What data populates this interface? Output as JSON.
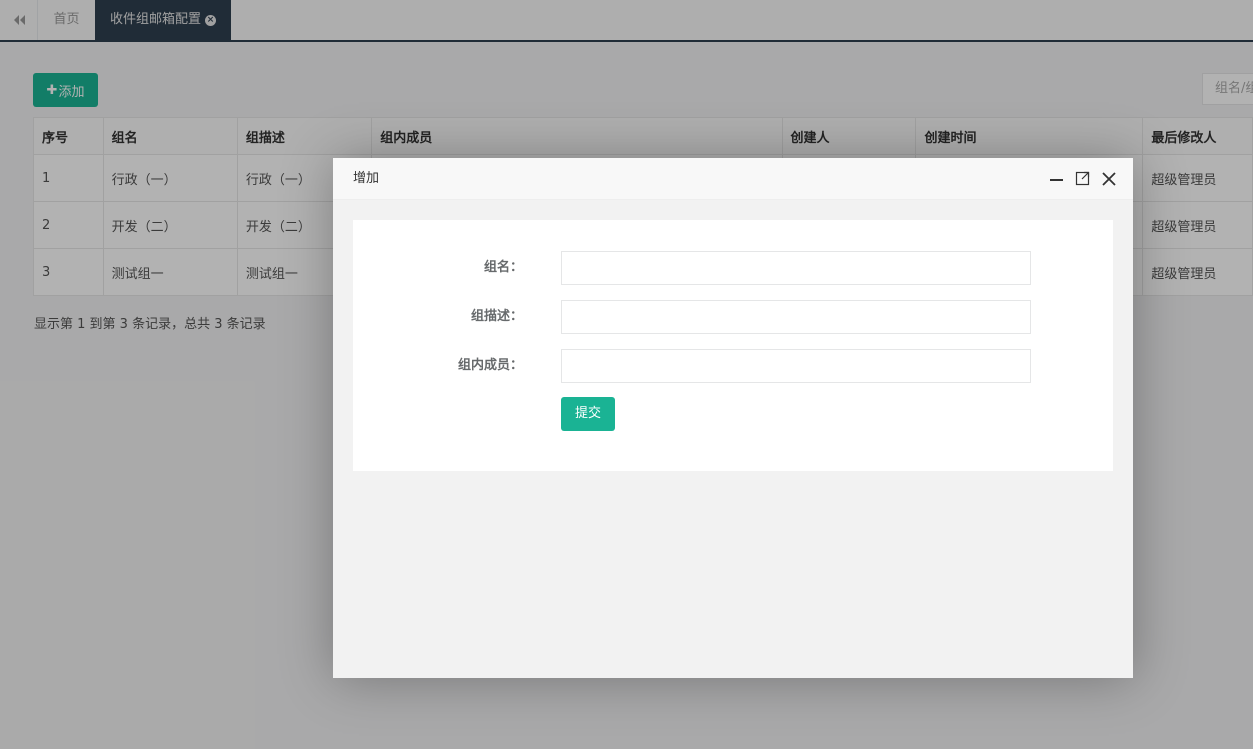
{
  "tabs": {
    "home_label": "首页",
    "active_label": "收件组邮箱配置"
  },
  "toolbar": {
    "add_label": "添加",
    "search_placeholder": "组名/组"
  },
  "table": {
    "headers": [
      "序号",
      "组名",
      "组描述",
      "组内成员",
      "创建人",
      "创建时间",
      "最后修改人"
    ],
    "rows": [
      [
        "1",
        "行政（一）",
        "行政（一）",
        "",
        "",
        "",
        "超级管理员"
      ],
      [
        "2",
        "开发（二）",
        "开发（二）",
        "",
        "",
        "",
        "超级管理员"
      ],
      [
        "3",
        "测试组一",
        "测试组一",
        "",
        "",
        "",
        "超级管理员"
      ]
    ]
  },
  "pager": {
    "info": "显示第 1 到第 3 条记录，总共 3 条记录"
  },
  "dialog": {
    "title": "增加",
    "fields": [
      {
        "label": "组名：",
        "value": ""
      },
      {
        "label": "组描述：",
        "value": ""
      },
      {
        "label": "组内成员：",
        "value": ""
      }
    ],
    "submit_label": "提交"
  },
  "colors": {
    "primary": "#1ab394",
    "nav_dark": "#2f4050"
  }
}
